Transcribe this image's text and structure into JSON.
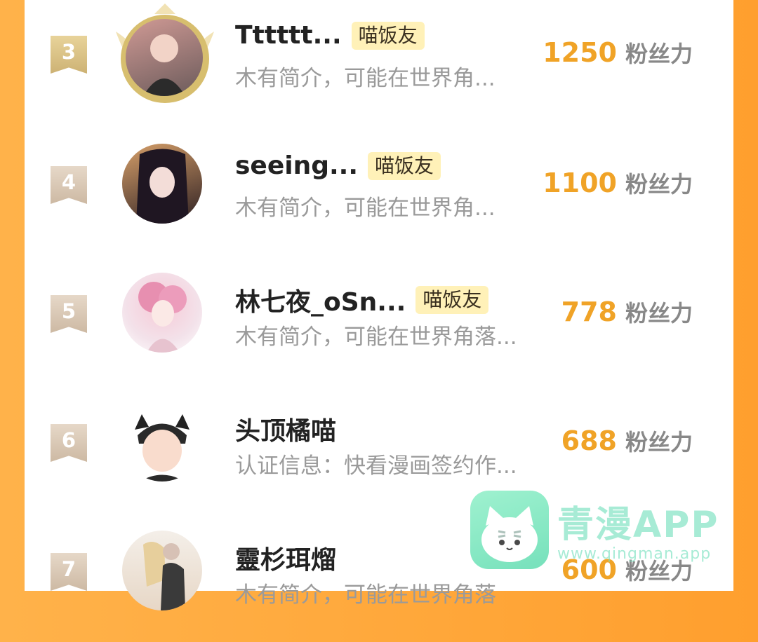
{
  "rows": [
    {
      "rank": "3",
      "name": "Tttttt...",
      "badge": "喵饭友",
      "intro": "木有简介，可能在世界角...",
      "fans": "1250",
      "unit": "粉丝力"
    },
    {
      "rank": "4",
      "name": "seeing...",
      "badge": "喵饭友",
      "intro": "木有简介，可能在世界角...",
      "fans": "1100",
      "unit": "粉丝力"
    },
    {
      "rank": "5",
      "name": "林七夜_oSn...",
      "badge": "喵饭友",
      "intro": "木有简介，可能在世界角落...",
      "fans": "778",
      "unit": "粉丝力"
    },
    {
      "rank": "6",
      "name": "头顶橘喵",
      "intro": "认证信息：快看漫画签约作...",
      "fans": "688",
      "unit": "粉丝力"
    },
    {
      "rank": "7",
      "name": "靈杉珥熘",
      "intro": "木有简介，可能在世界角落",
      "fans": "600",
      "unit": "粉丝力"
    }
  ],
  "watermark": {
    "title": "青漫APP",
    "url": "www.qingman.app"
  },
  "colors": {
    "accent": "#f0a327",
    "badge_bg": "#fff1b8",
    "side": "#ffa73a"
  }
}
